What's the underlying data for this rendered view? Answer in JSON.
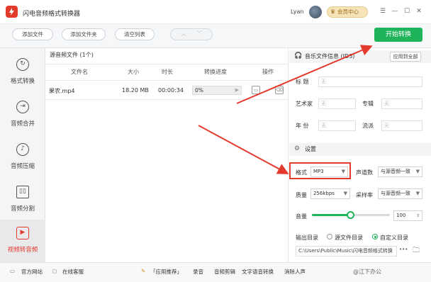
{
  "titlebar": {
    "app_title": "闪电音频格式转换器",
    "user_name": "Lyan",
    "vip_label": "会员中心",
    "menu_icon": "menu-icon",
    "minimize_icon": "minimize-icon",
    "maximize_icon": "maximize-icon",
    "close_icon": "close-icon"
  },
  "toolbar": {
    "add_file": "添加文件",
    "add_folder": "添加文件夹",
    "clear_list": "清空列表",
    "start": "开始转换"
  },
  "sidebar": {
    "items": [
      {
        "label": "格式转换",
        "icon": "refresh-icon"
      },
      {
        "label": "音频合并",
        "icon": "merge-icon"
      },
      {
        "label": "音频压缩",
        "icon": "compress-icon"
      },
      {
        "label": "音频分割",
        "icon": "split-icon"
      },
      {
        "label": "视频转音频",
        "icon": "video-icon"
      }
    ],
    "active_index": 4
  },
  "filelist": {
    "header": "源音频文件 (1个)",
    "columns": [
      "文件名",
      "大小",
      "时长",
      "转换进度",
      "操作"
    ],
    "rows": [
      {
        "name": "果农.mp4",
        "size": "18.20 MB",
        "duration": "00:00:34",
        "progress": "0%"
      }
    ]
  },
  "music_info": {
    "title": "音乐文件信息",
    "title_suffix": "(ID3)",
    "apply_all": "应用到全部",
    "fields": [
      {
        "label": "标 题",
        "value": "无"
      },
      {
        "label": "艺术家",
        "value": "无"
      },
      {
        "label": "专辑",
        "value": "无"
      },
      {
        "label": "年 份",
        "value": "无"
      },
      {
        "label": "流派",
        "value": "无"
      }
    ]
  },
  "settings": {
    "title": "设置",
    "format_label": "格式",
    "format_value": "MP3",
    "channels_label": "声道数",
    "channels_value": "与源音频一致",
    "quality_label": "质量",
    "quality_value": "256kbps",
    "samplerate_label": "采样率",
    "samplerate_value": "与源音频一致",
    "volume_label": "音量",
    "volume_value": "100",
    "volume_level": 0.5,
    "output_label": "输出目录",
    "output_option_source": "源文件目录",
    "output_option_custom": "自定义目录",
    "output_path": "C:\\Users\\Public\\Music\\闪电音频格式转换",
    "browse": "•••"
  },
  "statusbar": {
    "website": "官方网站",
    "service": "在线客服",
    "recommend": "「应用推荐」",
    "items": [
      "录音",
      "音频剪辑",
      "文字语音转换",
      "消除人声"
    ],
    "watermark": "@江下办公"
  },
  "colors": {
    "accent": "#1fb35a",
    "brand": "#e23a2b",
    "annotation": "#e33a2e"
  }
}
